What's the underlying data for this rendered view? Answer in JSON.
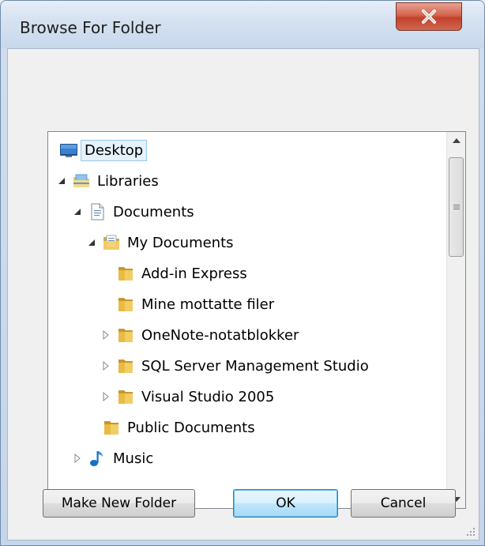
{
  "window": {
    "title": "Browse For Folder"
  },
  "tree": {
    "items": [
      {
        "label": "Desktop",
        "icon": "desktop-icon",
        "expander": "none",
        "selected": true
      },
      {
        "label": "Libraries",
        "icon": "libraries-icon",
        "expander": "expanded"
      },
      {
        "label": "Documents",
        "icon": "documents-library-icon",
        "expander": "expanded"
      },
      {
        "label": "My Documents",
        "icon": "documents-folder-icon",
        "expander": "expanded"
      },
      {
        "label": "Add-in Express",
        "icon": "folder-icon",
        "expander": "none"
      },
      {
        "label": "Mine mottatte filer",
        "icon": "folder-icon",
        "expander": "none"
      },
      {
        "label": "OneNote-notatblokker",
        "icon": "folder-icon",
        "expander": "collapsed"
      },
      {
        "label": "SQL Server Management Studio",
        "icon": "folder-icon",
        "expander": "collapsed"
      },
      {
        "label": "Visual Studio 2005",
        "icon": "folder-icon",
        "expander": "collapsed"
      },
      {
        "label": "Public Documents",
        "icon": "folder-icon",
        "expander": "none"
      },
      {
        "label": "Music",
        "icon": "music-icon",
        "expander": "collapsed"
      }
    ]
  },
  "buttons": {
    "make_new_folder": "Make New Folder",
    "ok": "OK",
    "cancel": "Cancel"
  },
  "colors": {
    "close_button": "#c8452f",
    "selection_fill": "#e5f1fb",
    "selection_border": "#99c9ef",
    "default_button_border": "#3c7fb1"
  }
}
